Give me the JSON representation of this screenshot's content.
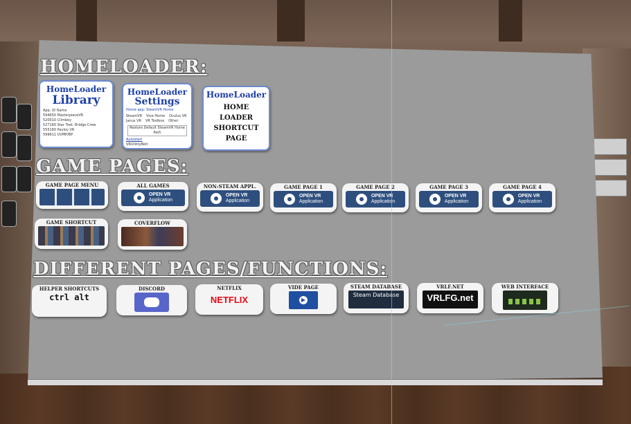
{
  "homeloader": {
    "title": "HOMELOADER:",
    "library": {
      "line1": "HomeLoader",
      "line2": "Library",
      "table_rows": [
        "App. ID   Name",
        "594650   MasterpieceVR",
        "520010   Climbey",
        "527160   Star Trek: Bridge Crew",
        "555160   Pavlov VR",
        "599611   UVMP/BP"
      ]
    },
    "settings": {
      "line1": "HomeLoader",
      "line2": "Settings",
      "tabs": "Home app:  SteamVR Home",
      "options": [
        "SteamVR",
        "Vive Home",
        "Oculus VR",
        "Janus VR",
        "VR Toolbox",
        "Other"
      ],
      "button": "Restore Default SteamVR Home Path",
      "autostart": "Autostart",
      "footer": "VRUtilityBelt"
    },
    "shortcut": {
      "line1": "HomeLoader",
      "line2": "HOME",
      "line3": "LOADER",
      "line4": "SHORTCUT",
      "line5": "PAGE"
    }
  },
  "game_pages": {
    "title": "GAME PAGES:",
    "tiles": [
      {
        "label": "GAME PAGE MENU",
        "kind": "thumb"
      },
      {
        "label": "ALL GAMES",
        "kind": "steam"
      },
      {
        "label": "NON-STEAM APPL.",
        "kind": "steam"
      },
      {
        "label": "GAME PAGE 1",
        "kind": "steam"
      },
      {
        "label": "GAME PAGE 2",
        "kind": "steam"
      },
      {
        "label": "GAME PAGE 3",
        "kind": "steam"
      },
      {
        "label": "GAME PAGE 4",
        "kind": "steam"
      },
      {
        "label": "GAME SHORTCUT",
        "kind": "thumb"
      },
      {
        "label": "COVERFLOW",
        "kind": "thumb"
      }
    ],
    "steam_text": {
      "line1": "OPEN VR",
      "line2": "Application"
    }
  },
  "functions": {
    "title": "DIFFERENT PAGES/FUNCTIONS:",
    "tiles": [
      {
        "label": "HELPER SHORTCUTS",
        "content": "ctrl alt"
      },
      {
        "label": "DISCORD",
        "content": ""
      },
      {
        "label": "NETFLIX",
        "content": "NETFLIX"
      },
      {
        "label": "VIDE PAGE",
        "content": ""
      },
      {
        "label": "STEAM DATABASE",
        "content": "Steam Database"
      },
      {
        "label": "VRLF.NET",
        "content": "VRLFG.net"
      },
      {
        "label": "WEB INTERFACE",
        "content": ""
      }
    ]
  },
  "colors": {
    "panel": "#9b9b9b",
    "steam_blue": "#2e4f7e",
    "homeloader_blue": "#1d3fa6",
    "discord": "#5865c9",
    "netflix": "#e50914"
  }
}
